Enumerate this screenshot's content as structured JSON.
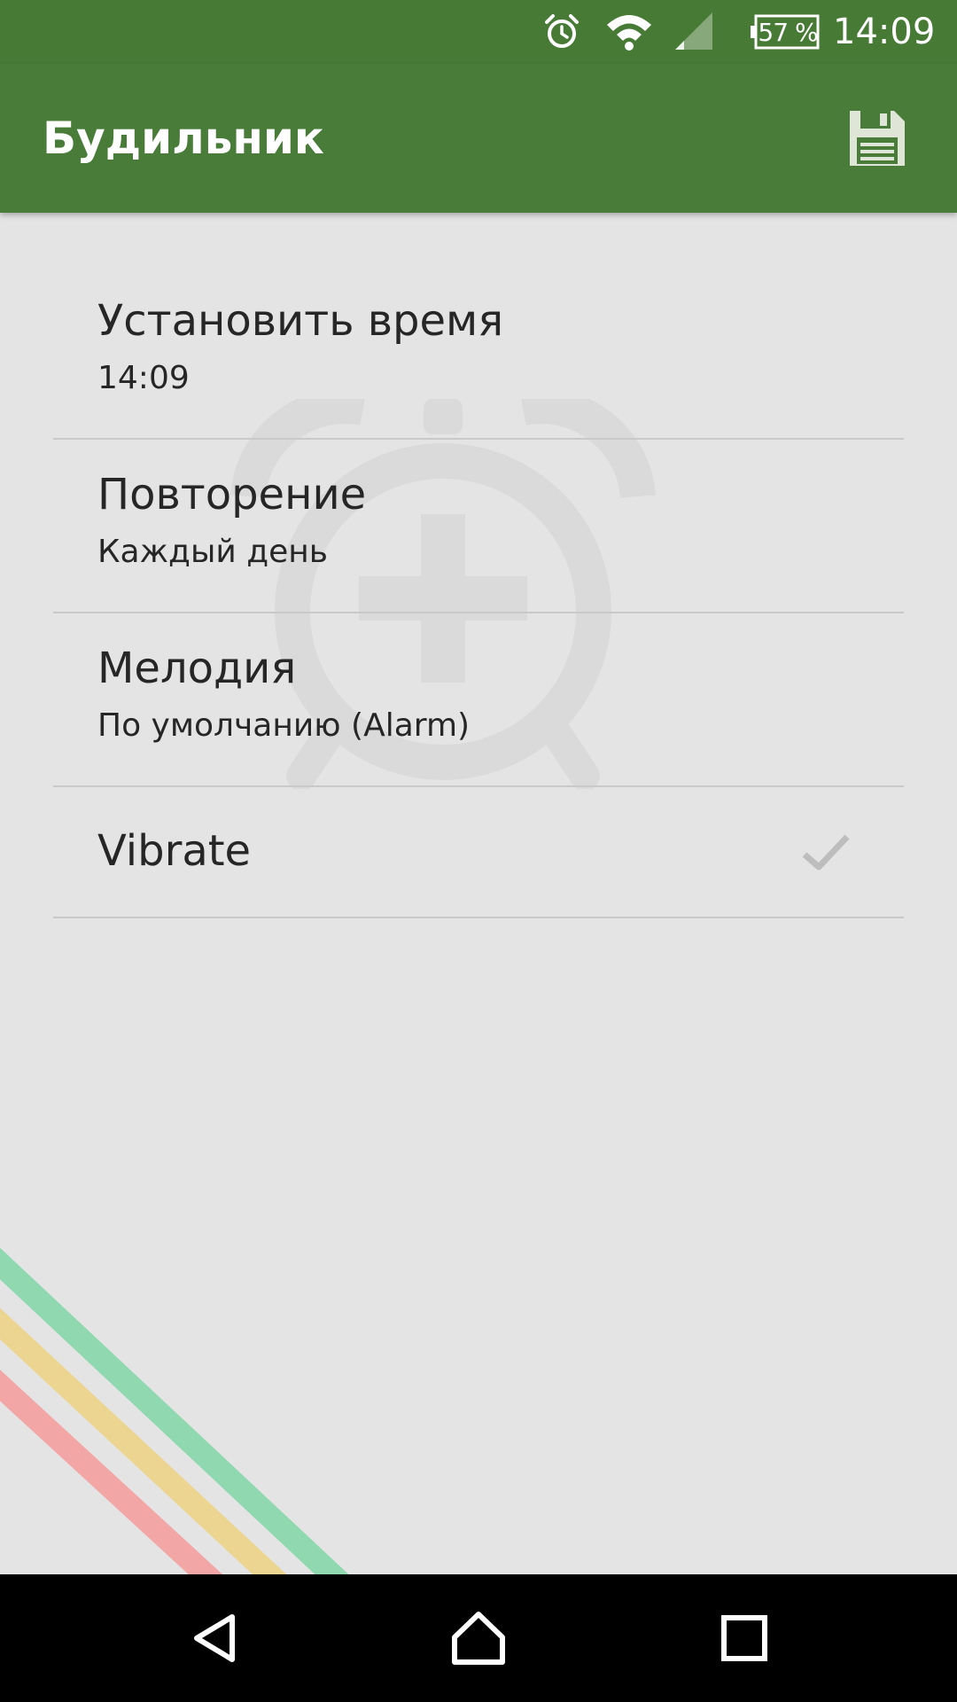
{
  "status_bar": {
    "battery_percent": "57 %",
    "time": "14:09",
    "icons": [
      "alarm-clock-icon",
      "wifi-icon",
      "cell-signal-icon",
      "battery-icon"
    ]
  },
  "app_bar": {
    "title": "Будильник",
    "actions": [
      "save-icon"
    ]
  },
  "settings": {
    "items": [
      {
        "title": "Установить время",
        "summary": "14:09"
      },
      {
        "title": "Повторение",
        "summary": "Каждый день"
      },
      {
        "title": "Мелодия",
        "summary": "По умолчанию (Alarm)"
      },
      {
        "title": "Vibrate",
        "checked": true
      }
    ]
  },
  "navigation": {
    "buttons": [
      "back-icon",
      "home-icon",
      "recents-icon"
    ]
  },
  "colors": {
    "status_bar": "#467a35",
    "app_bar": "#487c38",
    "background": "#e4e4e4",
    "stripe_green": "#8fd8b0",
    "stripe_yellow": "#ecd591",
    "stripe_red": "#f3a6a6"
  }
}
